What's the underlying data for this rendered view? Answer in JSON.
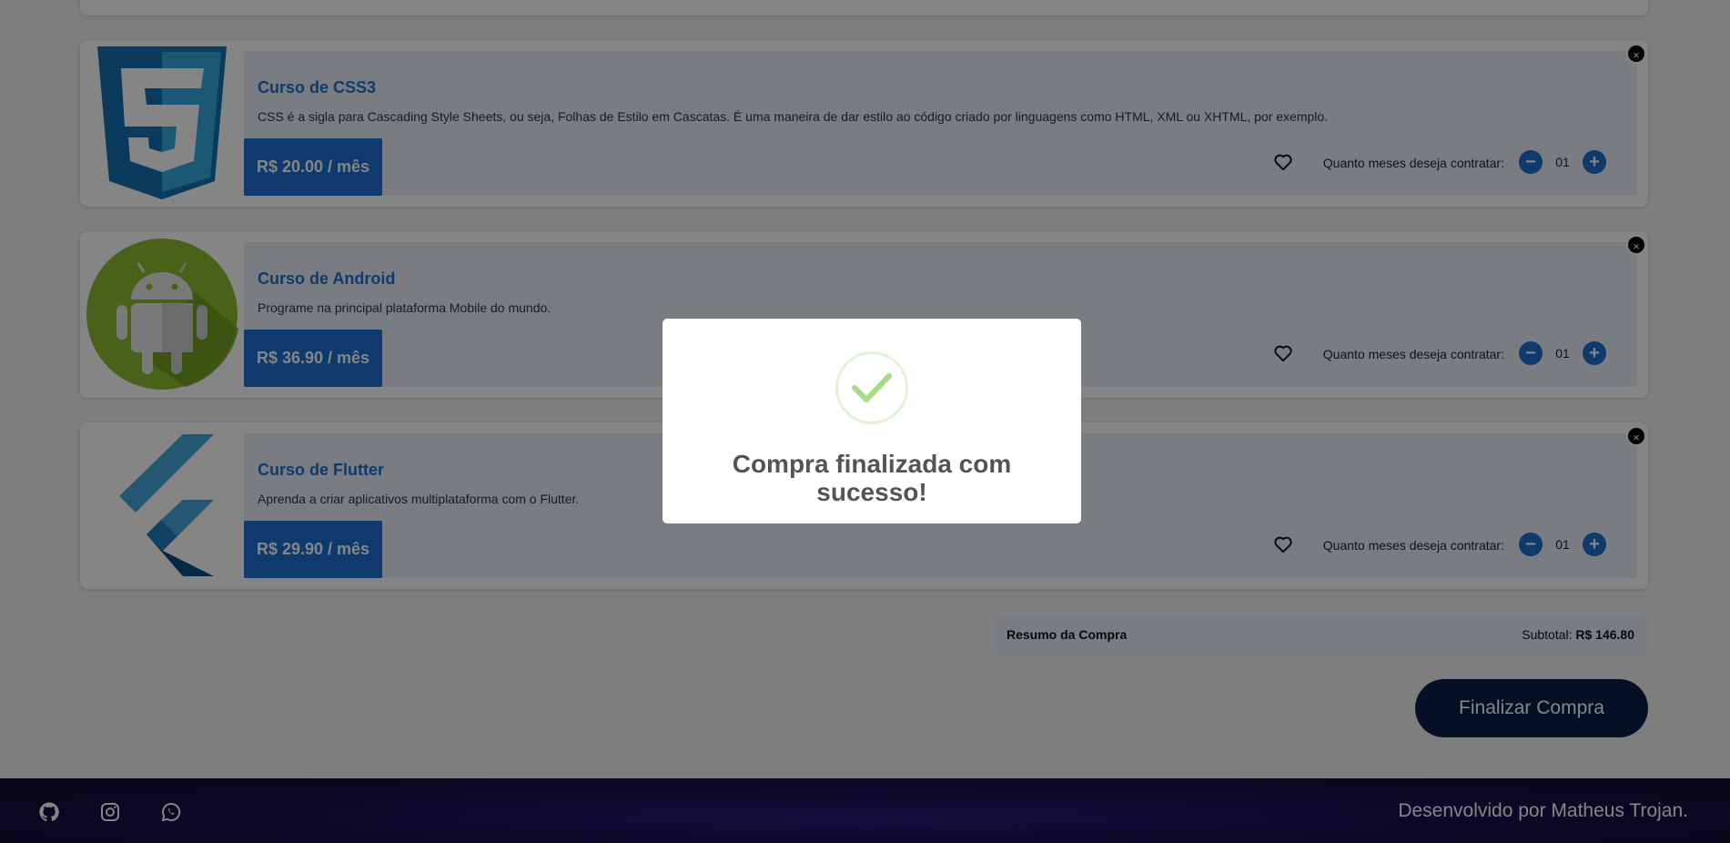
{
  "courses": [
    {
      "title": "Curso de CSS3",
      "description": "CSS é a sigla para Cascading Style Sheets, ou seja, Folhas de Estilo em Cascatas. É uma maneira de dar estilo ao código criado por linguagens como HTML, XML ou XHTML, por exemplo.",
      "price": "R$ 20.00 / mês",
      "months_label": "Quanto meses deseja contratar:",
      "quantity": "01",
      "logo": "css3-logo"
    },
    {
      "title": "Curso de Android",
      "description": "Programe na principal plataforma Mobile do mundo.",
      "price": "R$ 36.90 / mês",
      "months_label": "Quanto meses deseja contratar:",
      "quantity": "01",
      "logo": "android-logo"
    },
    {
      "title": "Curso de Flutter",
      "description": "Aprenda a criar aplicativos multiplataforma com o Flutter.",
      "price": "R$ 29.90 / mês",
      "months_label": "Quanto meses deseja contratar:",
      "quantity": "01",
      "logo": "flutter-logo"
    }
  ],
  "stepper": {
    "minus": "−",
    "plus": "+"
  },
  "close_glyph": "×",
  "summary": {
    "label": "Resumo da Compra",
    "subtotal_label": "Subtotal:",
    "subtotal_value": "R$ 146.80"
  },
  "checkout_button": "Finalizar Compra",
  "footer": {
    "icons": [
      "github-icon",
      "instagram-icon",
      "whatsapp-icon"
    ],
    "credit": "Desenvolvido por Matheus Trojan."
  },
  "modal": {
    "message": "Compra finalizada com sucesso!",
    "icon": "success-check-icon"
  },
  "colors": {
    "accent": "#1b6fd4",
    "checkout": "#0b1e47",
    "success": "#a5dc86"
  }
}
